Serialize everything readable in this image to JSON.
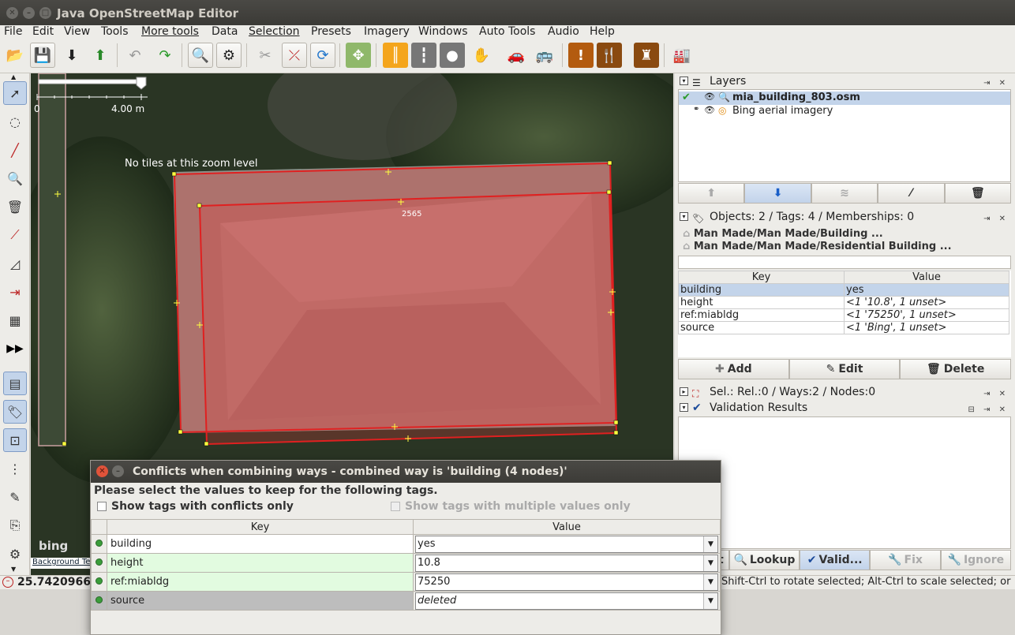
{
  "window": {
    "title": "Java OpenStreetMap Editor"
  },
  "menu": [
    "File",
    "Edit",
    "View",
    "Tools",
    "More tools",
    "Data",
    "Selection",
    "Presets",
    "Imagery",
    "Windows",
    "Auto Tools",
    "Audio",
    "Help"
  ],
  "map": {
    "scale_start": "0",
    "scale_end": "4.00 m",
    "no_tiles": "No tiles at this zoom level",
    "node_label": "2565",
    "attribution_logo": "bing",
    "attribution_text": "Background Ter"
  },
  "status": {
    "coordinate": "25.7420966",
    "hint": "Shift-Ctrl to rotate selected; Alt-Ctrl to scale selected; or cl"
  },
  "layers": {
    "title": "Layers",
    "items": [
      {
        "name": "mia_building_803.osm",
        "active": true
      },
      {
        "name": "Bing aerial imagery",
        "active": false
      }
    ]
  },
  "objects": {
    "title": "Objects: 2 / Tags: 4 / Memberships: 0",
    "presets": [
      "Man Made/Man Made/Building ...",
      "Man Made/Man Made/Residential Building ..."
    ],
    "col_key": "Key",
    "col_value": "Value",
    "rows": [
      {
        "key": "building",
        "value": "yes"
      },
      {
        "key": "height",
        "value": "<1 '10.8', 1 unset>"
      },
      {
        "key": "ref:miabldg",
        "value": "<1 '75250', 1 unset>"
      },
      {
        "key": "source",
        "value": "<1 'Bing', 1 unset>"
      }
    ],
    "add_label": "Add",
    "edit_label": "Edit",
    "delete_label": "Delete"
  },
  "selection": {
    "title": "Sel.: Rel.:0 / Ways:2 / Nodes:0"
  },
  "validation": {
    "title": "Validation Results",
    "select_label": "ect",
    "lookup_label": "Lookup",
    "valid_label": "Valid...",
    "fix_label": "Fix",
    "ignore_label": "Ignore"
  },
  "dialog": {
    "title": "Conflicts when combining ways - combined way is 'building (4 nodes)'",
    "instruction": "Please select the values to keep for the following tags.",
    "cb1": "Show tags with conflicts only",
    "cb2": "Show tags with multiple values only",
    "col_key": "Key",
    "col_value": "Value",
    "rows": [
      {
        "key": "building",
        "value": "yes"
      },
      {
        "key": "height",
        "value": "10.8"
      },
      {
        "key": "ref:miabldg",
        "value": "75250"
      },
      {
        "key": "source",
        "value": "deleted"
      }
    ]
  }
}
